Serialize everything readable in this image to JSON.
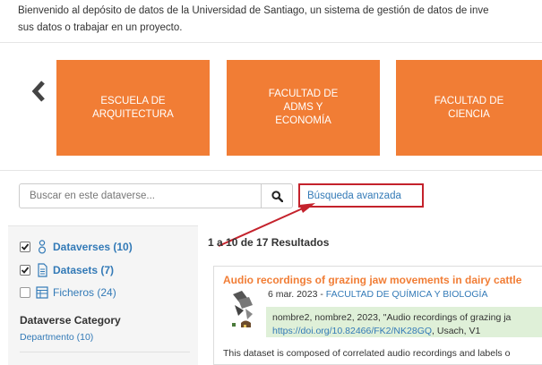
{
  "intro": {
    "line1": "Bienvenido al depósito de datos de la Universidad de Santiago, un sistema de gestión de datos de inve",
    "line2": "sus datos o trabajar en un proyecto."
  },
  "carousel": {
    "prev_icon": "chevron-left-icon",
    "tiles": [
      {
        "label": "ESCUELA DE\nARQUITECTURA"
      },
      {
        "label": "FACULTAD DE\nADMS Y\nECONOMÍA"
      },
      {
        "label": "FACULTAD DE\nCIENCIA"
      }
    ],
    "tile_color": "#f17d35"
  },
  "search": {
    "placeholder": "Buscar en este dataverse...",
    "button_icon": "search-icon",
    "advanced_label": "Búsqueda avanzada"
  },
  "facets": {
    "dataverses": {
      "label": "Dataverses (10)",
      "checked": true,
      "icon": "dataverse-icon"
    },
    "datasets": {
      "label": "Datasets (7)",
      "checked": true,
      "icon": "dataset-icon"
    },
    "files": {
      "label": "Ficheros (24)",
      "checked": false,
      "icon": "file-icon"
    },
    "category_title": "Dataverse Category",
    "category_item": "Departmento (10)"
  },
  "results": {
    "count_text": "1 a 10 de 17 Resultados",
    "items": [
      {
        "title": "Audio recordings of grazing jaw movements in dairy cattle",
        "date": "6 mar. 2023 - ",
        "affiliation": "FACULTAD DE QUÍMICA Y BIOLOGÍA",
        "citation": "nombre2, nombre2, 2023, \"Audio recordings of grazing ja",
        "doi": "https://doi.org/10.82466/FK2/NK28GQ",
        "citation_tail": ", Usach, V1",
        "description": "This dataset is composed of correlated audio recordings and labels o"
      }
    ]
  },
  "colors": {
    "accent_orange": "#f17d35",
    "link_blue": "#337ab7",
    "annotation_red": "#c4222c",
    "citation_green": "#dff0d8"
  }
}
